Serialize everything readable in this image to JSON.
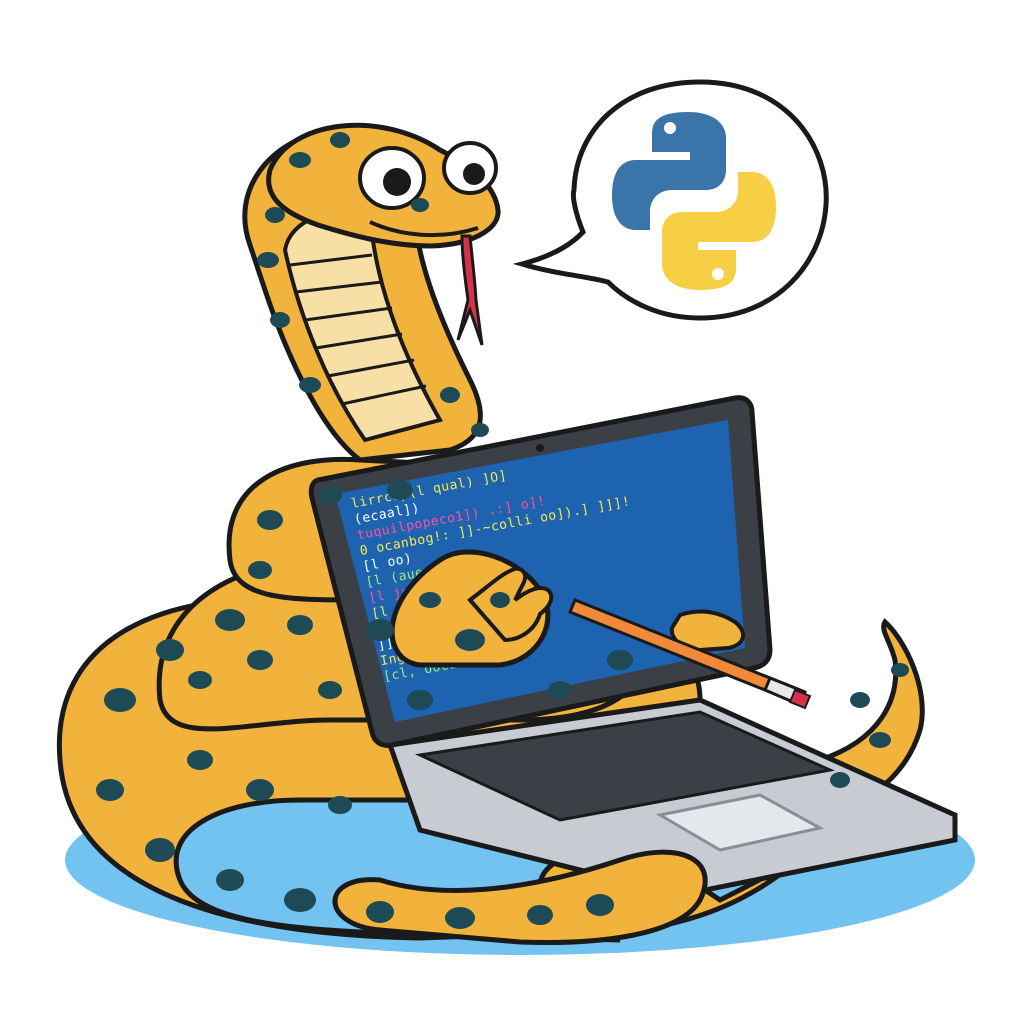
{
  "scene": {
    "subject": "cartoon-snake-with-laptop",
    "speech_bubble_icon": "python-logo-icon",
    "colors": {
      "background": "#ffffff",
      "shadow": "#5bb8ee",
      "snake_skin": "#f2b33d",
      "snake_spots": "#1d4a55",
      "snake_belly": "#f7dfa6",
      "outline": "#1a1a1a",
      "tongue": "#d8324a",
      "laptop_body": "#c8ccd2",
      "laptop_dark": "#3b3f46",
      "screen": "#1e63b0",
      "python_blue": "#3b74a8",
      "python_yellow": "#f7cf45",
      "pencil": "#f08a3a"
    }
  },
  "screen_code": [
    {
      "text": "lirrcop(l qual) ]O]",
      "color": "#f5e94a"
    },
    {
      "text": "    (ecaal])",
      "color": "#ffffff"
    },
    {
      "text": "        tuquilpopeco1]) .:]    o]!",
      "color": "#ff4fa0"
    },
    {
      "text": "  0      ocanbog!:    ]]-~colli oo]).] ]]]!",
      "color": "#f5e94a"
    },
    {
      "text": "  [l       oo)",
      "color": "#ffffff"
    },
    {
      "text": "  [l       (aueu   ]]!",
      "color": "#9bf06a"
    },
    {
      "text": "  [l     juqqqu",
      "color": "#ff4fa0"
    },
    {
      "text": "  [l",
      "color": "#f5e94a"
    },
    {
      "text": "                              ]!]]",
      "color": "#ffffff"
    },
    {
      "text": "                        ]], oeop]!",
      "color": "#ffffff"
    },
    {
      "text": "          Ing oDonl:]]]",
      "color": "#f5e94a"
    },
    {
      "text": "  [cl,      oocaui]ooe  ]]",
      "color": "#9bf06a"
    }
  ]
}
